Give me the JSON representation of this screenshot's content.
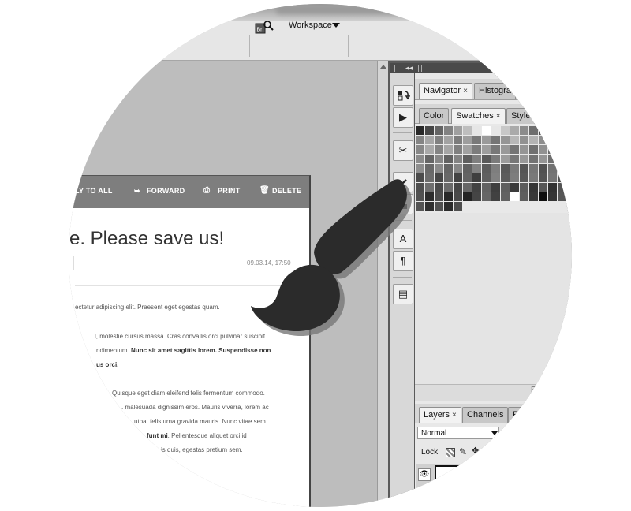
{
  "toolbar": {
    "bridge_icon": "bridge-search-icon",
    "bridge_label": "Br",
    "workspace_label": "Workspace"
  },
  "email": {
    "actions": [
      {
        "label": "LY TO ALL",
        "icon": ""
      },
      {
        "label": "FORWARD",
        "icon": "forward-icon"
      },
      {
        "label": "PRINT",
        "icon": "print-icon"
      },
      {
        "label": "DELETE",
        "icon": "trash-icon"
      }
    ],
    "title": "re. Please save us!",
    "date": "09.03.14, 17:50",
    "p1": "ectetur adipiscing elit. Praesent eget egestas quam.",
    "p2_1": "l, molestie cursus massa. Cras convallis orci pulvinar suscipit",
    "p2_2a": "ndimentum. ",
    "p2_2b": "Nunc sit amet sagittis lorem. Suspendisse non",
    "p2_3": "us orci.",
    "p3_1": "Quisque eget diam eleifend felis fermentum commodo.",
    "p3_2": ". malesuada dignissim eros. Mauris viverra, lorem ac",
    "p3_3": "utpat felis urna gravida mauris. Nunc vitae sem",
    "p3_4a": "funt mi",
    "p3_4b": ". Pellentesque aliquet orci id",
    "p3_5": "is quis, egestas pretium sem."
  },
  "tools": {
    "icons": [
      "history-brush-icon",
      "actions-play-icon",
      "tools-icon",
      "brush-presets-icon",
      "clone-source-icon",
      "character-icon",
      "paragraph-icon",
      "notes-icon"
    ],
    "glyphs": {
      "actions": "▶",
      "tools": "✂",
      "character": "A",
      "paragraph": "¶",
      "notes": "▤"
    }
  },
  "panels": {
    "tabs_top": [
      {
        "label": "Navigator",
        "close": "×"
      },
      {
        "label": "Histogra",
        "close": ""
      }
    ],
    "tabs_mid": [
      {
        "label": "Color",
        "close": ""
      },
      {
        "label": "Swatches",
        "close": "×"
      },
      {
        "label": "Style",
        "close": ""
      }
    ],
    "footer_text": "F",
    "layers_tabs": [
      {
        "label": "Layers",
        "close": "×"
      },
      {
        "label": "Channels",
        "close": ""
      },
      {
        "label": "P",
        "close": ""
      }
    ],
    "blend_mode": "Normal",
    "lock_label": "Lock:",
    "lock_icons": [
      "lock-transparent-icon",
      "lock-brush-icon",
      "lock-move-icon"
    ],
    "layer_visibility_icon": "eye-icon"
  },
  "overlay": {
    "icon": "paintbrush-icon"
  }
}
